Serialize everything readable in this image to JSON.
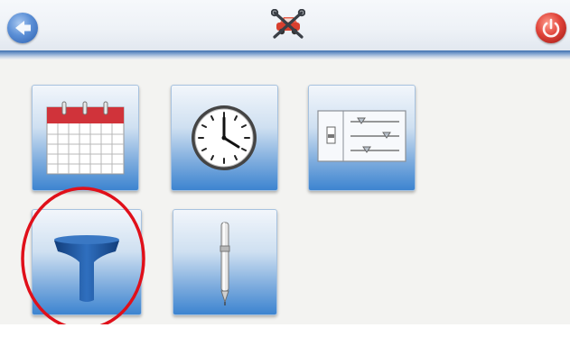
{
  "header": {
    "back_icon": "back-arrow-icon",
    "title_icon": "vehicle-tools-icon",
    "power_icon": "power-icon"
  },
  "colors": {
    "header_rule": "#3f6fae",
    "tile_gradient_top": "#f2f6fb",
    "tile_gradient_bottom": "#3d84d0",
    "back_button": "#5b8fd6",
    "power_button": "#e0443a",
    "highlight_ring": "#e0101a",
    "screen_background": "#f3f3f1"
  },
  "tiles": [
    {
      "id": "calendar",
      "icon": "calendar-icon"
    },
    {
      "id": "clock",
      "icon": "clock-icon"
    },
    {
      "id": "settings",
      "icon": "sliders-settings-icon"
    },
    {
      "id": "probe",
      "icon": "t-probe-icon",
      "highlighted": true
    },
    {
      "id": "stylus",
      "icon": "stylus-pen-icon"
    }
  ]
}
